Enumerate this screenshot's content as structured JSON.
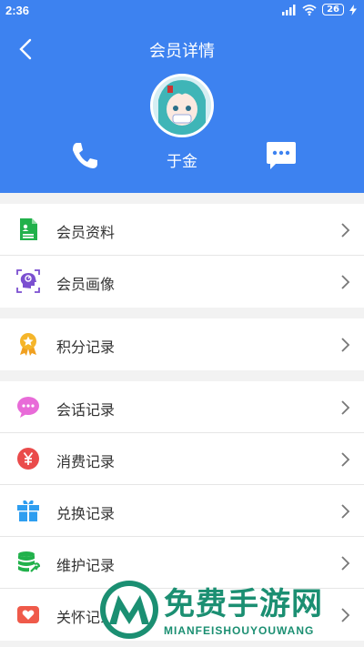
{
  "status_bar": {
    "time": "2:36",
    "battery": "26"
  },
  "header": {
    "title": "会员详情",
    "member_name": "于金"
  },
  "colors": {
    "primary": "#3d82f0",
    "background": "#f2f2f2"
  },
  "groups": [
    {
      "items": [
        {
          "label": "会员资料",
          "icon": "member-profile-icon"
        },
        {
          "label": "会员画像",
          "icon": "member-portrait-icon"
        }
      ]
    },
    {
      "items": [
        {
          "label": "积分记录",
          "icon": "points-medal-icon"
        }
      ]
    },
    {
      "items": [
        {
          "label": "会话记录",
          "icon": "chat-bubble-icon"
        },
        {
          "label": "消费记录",
          "icon": "yen-icon"
        },
        {
          "label": "兑换记录",
          "icon": "gift-icon"
        },
        {
          "label": "维护记录",
          "icon": "database-wrench-icon"
        },
        {
          "label": "关怀记录",
          "icon": "heart-card-icon"
        }
      ]
    }
  ],
  "watermark": {
    "title": "免费手游网",
    "subtitle": "MIANFEISHOUYOUWANG"
  }
}
